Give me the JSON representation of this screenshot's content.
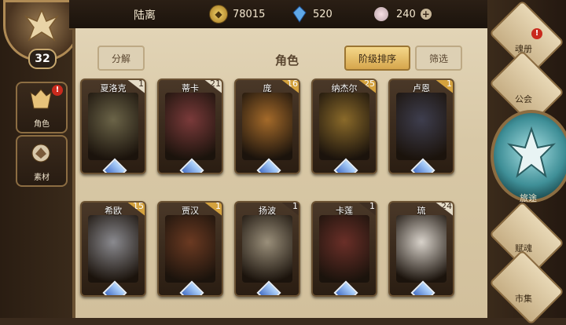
{
  "player": {
    "name": "陆离",
    "level": "32"
  },
  "resources": [
    {
      "icon": "gold-coin-icon",
      "value": "78015"
    },
    {
      "icon": "blue-crystal-icon",
      "value": "520"
    },
    {
      "icon": "pink-gem-icon",
      "value": "240"
    }
  ],
  "left_tabs": [
    {
      "label": "角色",
      "icon": "hero-icon",
      "alert": "!"
    },
    {
      "label": "素材",
      "icon": "material-icon"
    }
  ],
  "header": {
    "title": "角色",
    "decompose_label": "分解",
    "sort_label": "阶级排序",
    "filter_label": "筛选"
  },
  "cards": [
    {
      "name": "夏洛克",
      "count": "1",
      "badge": "light",
      "bg": "#6b6448"
    },
    {
      "name": "蒂卡",
      "count": "21",
      "badge": "light",
      "bg": "#7a3a3a"
    },
    {
      "name": "庞",
      "count": "16",
      "badge": "gold",
      "bg": "#a46a2a"
    },
    {
      "name": "纳杰尔",
      "count": "25",
      "badge": "gold",
      "bg": "#8a6a2a"
    },
    {
      "name": "卢恩",
      "count": "1",
      "badge": "gold",
      "bg": "#3e3e4e"
    },
    {
      "name": "希欧",
      "count": "15",
      "badge": "gold",
      "bg": "#8a8a8f"
    },
    {
      "name": "贾汉",
      "count": "1",
      "badge": "gold",
      "bg": "#6b3a22"
    },
    {
      "name": "扬波",
      "count": "1",
      "badge": "dark",
      "bg": "#9a8f7a"
    },
    {
      "name": "卡莲",
      "count": "1",
      "badge": "dark",
      "bg": "#6a2f28"
    },
    {
      "name": "琉",
      "count": "24",
      "badge": "light",
      "bg": "#d8d2ca"
    }
  ],
  "right_menu": {
    "soul_book": "魂册",
    "guild": "公会",
    "journey": "旅途",
    "talent": "赋魂",
    "market": "市集",
    "soul_alert": "!"
  }
}
